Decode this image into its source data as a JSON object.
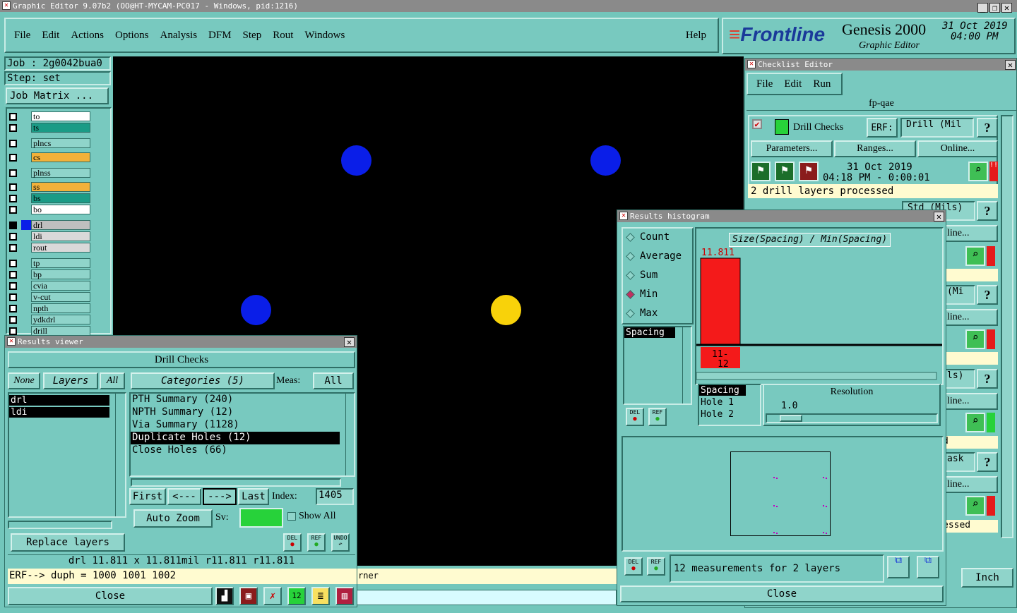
{
  "window": {
    "title": "Graphic Editor 9.07b2 (OO@HT-MYCAM-PC017 - Windows, pid:1216)"
  },
  "menubar": {
    "items": [
      "File",
      "Edit",
      "Actions",
      "Options",
      "Analysis",
      "DFM",
      "Step",
      "Rout",
      "Windows"
    ],
    "help": "Help"
  },
  "brand": {
    "logo": "Frontline",
    "product": "Genesis 2000",
    "subtitle": "Graphic Editor",
    "date": "31 Oct 2019",
    "time": "04:00 PM"
  },
  "job": {
    "job_label": "Job : 2g0042bua0",
    "step_label": "Step: set",
    "matrix_button": "Job Matrix ..."
  },
  "layers": [
    {
      "name": "to",
      "color": "#ffffff"
    },
    {
      "name": "ts",
      "color": "#1b9b86"
    },
    {
      "name": "plncs",
      "color": "#8fd4ca"
    },
    {
      "name": "cs",
      "color": "#f2b13a"
    },
    {
      "name": "plnss",
      "color": "#8fd4ca"
    },
    {
      "name": "ss",
      "color": "#f2b13a"
    },
    {
      "name": "bs",
      "color": "#1b9b86"
    },
    {
      "name": "bo",
      "color": "#ffffff"
    },
    {
      "name": "drl",
      "color": "#bfbfbf"
    },
    {
      "name": "ldi",
      "color": "#d9d9d9"
    },
    {
      "name": "rout",
      "color": "#d9d9d9"
    },
    {
      "name": "tp",
      "color": "#8fd4ca"
    },
    {
      "name": "bp",
      "color": "#8fd4ca"
    },
    {
      "name": "cvia",
      "color": "#8fd4ca"
    },
    {
      "name": "v-cut",
      "color": "#8fd4ca"
    },
    {
      "name": "npth",
      "color": "#8fd4ca"
    },
    {
      "name": "ydkdrl",
      "color": "#8fd4ca"
    },
    {
      "name": "drill",
      "color": "#8fd4ca"
    }
  ],
  "status_strip": {
    "text": "rner"
  },
  "checklist": {
    "title": "Checklist Editor",
    "menu": [
      "File",
      "Edit",
      "Run"
    ],
    "name": "fp-qae",
    "check_name": "Drill Checks",
    "erf_label": "ERF:",
    "erf_value": "Drill (Mil",
    "buttons": [
      "Parameters...",
      "Ranges...",
      "Online..."
    ],
    "run_date": "31 Oct 2019",
    "run_time": "04:18 PM - 0:00:01",
    "message": "2 drill layers processed",
    "partial_erf": "Std (Mils)",
    "partial_online": "line...",
    "partial_mi": "(Mi",
    "partial_ls": "ls)",
    "partial_d": "d",
    "partial_ask": "ask",
    "partial_essed": "essed",
    "units": "Inch"
  },
  "histogram": {
    "title": "Results histogram",
    "modes": [
      "Count",
      "Average",
      "Sum",
      "Min",
      "Max"
    ],
    "selected_mode": "Min",
    "list_item": "Spacing",
    "chart_title": "Size(Spacing) / Min(Spacing)",
    "bar_value": "11.811",
    "bar_label": "11-12",
    "meas": [
      "Spacing",
      "Hole 1",
      "Hole 2"
    ],
    "resolution_label": "Resolution",
    "resolution_value": "1.0",
    "summary": "12 measurements for 2 layers",
    "close": "Close",
    "del": "DEL",
    "ref": "REF"
  },
  "chart_data": {
    "type": "bar",
    "title": "Size(Spacing) / Min(Spacing)",
    "categories": [
      "11-12"
    ],
    "values": [
      11.811
    ],
    "xlabel": "",
    "ylabel": ""
  },
  "viewer": {
    "title": "Results viewer",
    "check": "Drill Checks",
    "layer_buttons": [
      "None",
      "Layers",
      "All"
    ],
    "layers": [
      "drl",
      "ldi"
    ],
    "categories_label": "Categories (5)",
    "meas_label": "Meas:",
    "meas_value": "All",
    "categories": [
      "PTH Summary (240)",
      "NPTH Summary (12)",
      "Via Summary (1128)",
      "Duplicate Holes (12)",
      "Close Holes (66)"
    ],
    "selected_category": "Duplicate Holes (12)",
    "nav": [
      "First",
      "<---",
      "--->",
      "Last"
    ],
    "index_label": "Index:",
    "index_value": "1405",
    "auto_zoom": "Auto Zoom",
    "sv_label": "Sv:",
    "show_all": "Show All",
    "replace": "Replace layers",
    "info": "drl  11.811 x 11.811mil   r11.811  r11.811",
    "erf": "ERF--> duph = 1000 1001 1002",
    "close": "Close",
    "del": "DEL",
    "ref": "REF",
    "undo": "UNDO"
  }
}
